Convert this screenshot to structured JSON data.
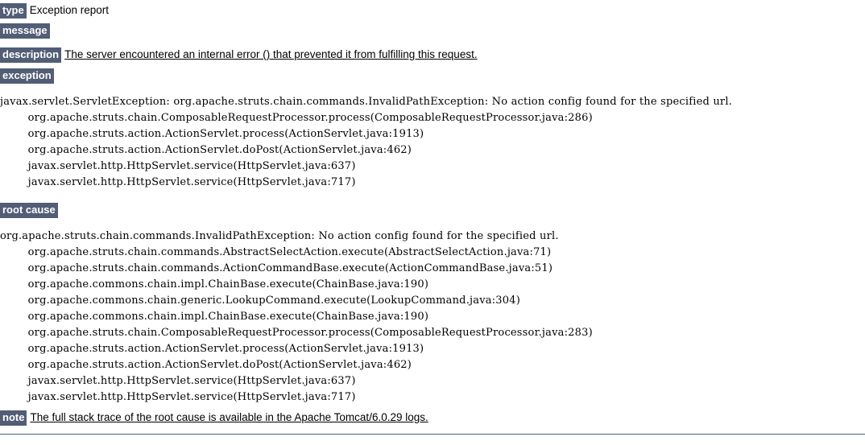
{
  "page": {
    "title": "Apache Tomcat Exception Report",
    "accent_color": "#525D76",
    "text_color": "#000000",
    "background_color": "#FFFFFF"
  },
  "fields": {
    "type_label": "type",
    "type_value": "Exception report",
    "message_label": "message",
    "message_value": "",
    "description_label": "description",
    "description_value": "The server encountered an internal error () that prevented it from fulfilling this request.",
    "exception_label": "exception",
    "root_cause_label": "root cause",
    "note_label": "note",
    "note_value": "The full stack trace of the root cause is available in the Apache Tomcat/6.0.29 logs."
  },
  "exception_trace": "javax.servlet.ServletException: org.apache.struts.chain.commands.InvalidPathException: No action config found for the specified url.\n        org.apache.struts.chain.ComposableRequestProcessor.process(ComposableRequestProcessor.java:286)\n        org.apache.struts.action.ActionServlet.process(ActionServlet.java:1913)\n        org.apache.struts.action.ActionServlet.doPost(ActionServlet.java:462)\n        javax.servlet.http.HttpServlet.service(HttpServlet.java:637)\n        javax.servlet.http.HttpServlet.service(HttpServlet.java:717)",
  "root_cause_trace": "org.apache.struts.chain.commands.InvalidPathException: No action config found for the specified url.\n        org.apache.struts.chain.commands.AbstractSelectAction.execute(AbstractSelectAction.java:71)\n        org.apache.struts.chain.commands.ActionCommandBase.execute(ActionCommandBase.java:51)\n        org.apache.commons.chain.impl.ChainBase.execute(ChainBase.java:190)\n        org.apache.commons.chain.generic.LookupCommand.execute(LookupCommand.java:304)\n        org.apache.commons.chain.impl.ChainBase.execute(ChainBase.java:190)\n        org.apache.struts.chain.ComposableRequestProcessor.process(ComposableRequestProcessor.java:283)\n        org.apache.struts.action.ActionServlet.process(ActionServlet.java:1913)\n        org.apache.struts.action.ActionServlet.doPost(ActionServlet.java:462)\n        javax.servlet.http.HttpServlet.service(HttpServlet.java:637)\n        javax.servlet.http.HttpServlet.service(HttpServlet.java:717)",
  "exception_frames": [
    "javax.servlet.ServletException: org.apache.struts.chain.commands.InvalidPathException: No action config found for the specified url.",
    "org.apache.struts.chain.ComposableRequestProcessor.process(ComposableRequestProcessor.java:286)",
    "org.apache.struts.action.ActionServlet.process(ActionServlet.java:1913)",
    "org.apache.struts.action.ActionServlet.doPost(ActionServlet.java:462)",
    "javax.servlet.http.HttpServlet.service(HttpServlet.java:637)",
    "javax.servlet.http.HttpServlet.service(HttpServlet.java:717)"
  ],
  "root_cause_frames": [
    "org.apache.struts.chain.commands.InvalidPathException: No action config found for the specified url.",
    "org.apache.struts.chain.commands.AbstractSelectAction.execute(AbstractSelectAction.java:71)",
    "org.apache.struts.chain.commands.ActionCommandBase.execute(ActionCommandBase.java:51)",
    "org.apache.commons.chain.impl.ChainBase.execute(ChainBase.java:190)",
    "org.apache.commons.chain.generic.LookupCommand.execute(LookupCommand.java:304)",
    "org.apache.commons.chain.impl.ChainBase.execute(ChainBase.java:190)",
    "org.apache.struts.chain.ComposableRequestProcessor.process(ComposableRequestProcessor.java:283)",
    "org.apache.struts.action.ActionServlet.process(ActionServlet.java:1913)",
    "org.apache.struts.action.ActionServlet.doPost(ActionServlet.java:462)",
    "javax.servlet.http.HttpServlet.service(HttpServlet.java:637)",
    "javax.servlet.http.HttpServlet.service(HttpServlet.java:717)"
  ]
}
